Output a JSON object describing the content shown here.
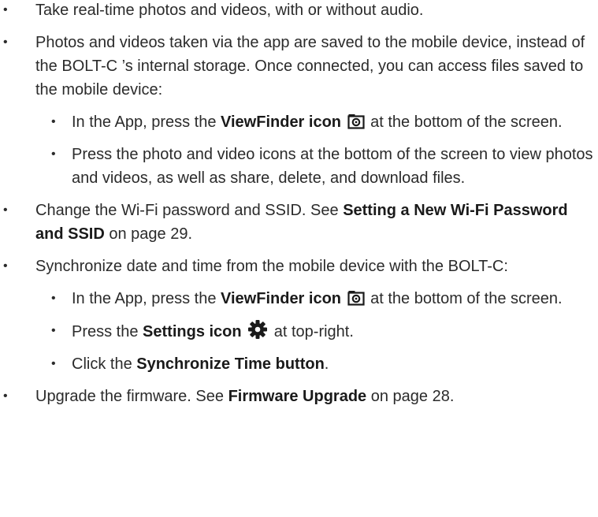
{
  "items": [
    {
      "text": "Take real-time photos and videos, with or without audio."
    },
    {
      "text": "Photos and videos taken via the app are saved to the mobile device, instead of the BOLT-C ’s internal storage. Once connected, you can access files saved to the mobile device:",
      "sub": [
        {
          "pre": "In the App, press the ",
          "bold": "ViewFinder icon",
          "icon": "camera-icon",
          "post": " at the bottom of the screen."
        },
        {
          "text": "Press the photo and video icons at the bottom of the screen to view photos and videos, as well as share, delete, and download files."
        }
      ]
    },
    {
      "pre": "Change the Wi-Fi password and SSID. See ",
      "bold": "Setting a New Wi-Fi Password and SSID",
      "post": " on page 29."
    },
    {
      "text": "Synchronize date and time from the mobile device with the BOLT-C:",
      "sub": [
        {
          "pre": "In the App, press the ",
          "bold": "ViewFinder icon",
          "icon": "camera-icon",
          "post": " at the bottom of the screen."
        },
        {
          "pre": "Press the ",
          "bold": "Settings icon",
          "icon": "gear-icon",
          "post": " at top-right."
        },
        {
          "pre": "Click the ",
          "bold": "Synchronize Time button",
          "post": "."
        }
      ]
    },
    {
      "pre": "Upgrade the firmware. See ",
      "bold": "Firmware Upgrade",
      "post": " on page 28."
    }
  ]
}
